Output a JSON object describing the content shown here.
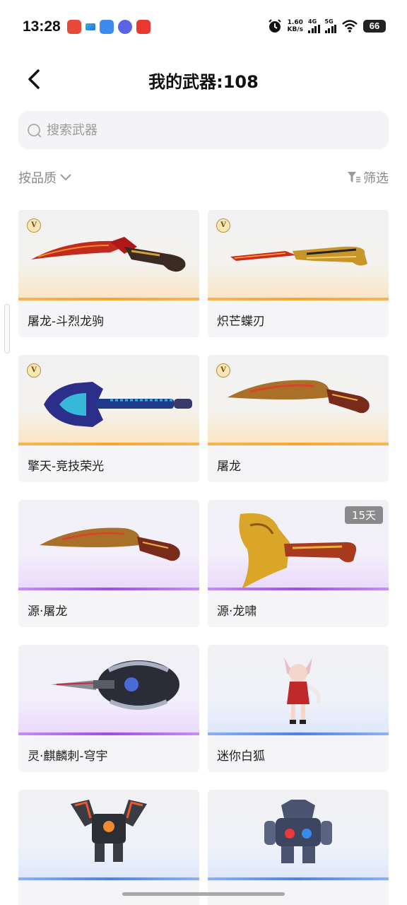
{
  "status_bar": {
    "time": "13:28",
    "net_speed_value": "1.60",
    "net_speed_unit": "KB/s",
    "sim1": "4G",
    "sim2": "5G",
    "battery": "66",
    "icons": [
      "app-red-icon",
      "app-bluegreen-icon",
      "app-blue-icon",
      "app-purple-icon",
      "app-redvideo-icon",
      "alarm-icon",
      "signal-icon",
      "wifi-icon",
      "battery-icon"
    ]
  },
  "header": {
    "title": "我的武器:108",
    "back_icon": "chevron-left-icon"
  },
  "search": {
    "placeholder": "搜索武器",
    "value": ""
  },
  "filters": {
    "sort_label": "按品质",
    "filter_label": "筛选"
  },
  "colors": {
    "gold": "#f3a733",
    "purple": "#9b4ee6",
    "blue": "#4d80e8"
  },
  "items": [
    {
      "name": "屠龙-斗烈龙驹",
      "tier": "gold",
      "v_badge": "V",
      "duration": ""
    },
    {
      "name": "炽芒蝶刃",
      "tier": "gold",
      "v_badge": "V",
      "duration": ""
    },
    {
      "name": "擎天-竞技荣光",
      "tier": "gold",
      "v_badge": "V",
      "duration": ""
    },
    {
      "name": "屠龙",
      "tier": "gold",
      "v_badge": "V",
      "duration": ""
    },
    {
      "name": "源·屠龙",
      "tier": "purple",
      "v_badge": "",
      "duration": ""
    },
    {
      "name": "源·龙啸",
      "tier": "purple",
      "v_badge": "",
      "duration": "15天"
    },
    {
      "name": "灵·麒麟刺-穹宇",
      "tier": "purple",
      "v_badge": "",
      "duration": ""
    },
    {
      "name": "迷你白狐",
      "tier": "blue",
      "v_badge": "",
      "duration": ""
    },
    {
      "name": "",
      "tier": "blue",
      "v_badge": "",
      "duration": ""
    },
    {
      "name": "",
      "tier": "blue",
      "v_badge": "",
      "duration": ""
    }
  ]
}
